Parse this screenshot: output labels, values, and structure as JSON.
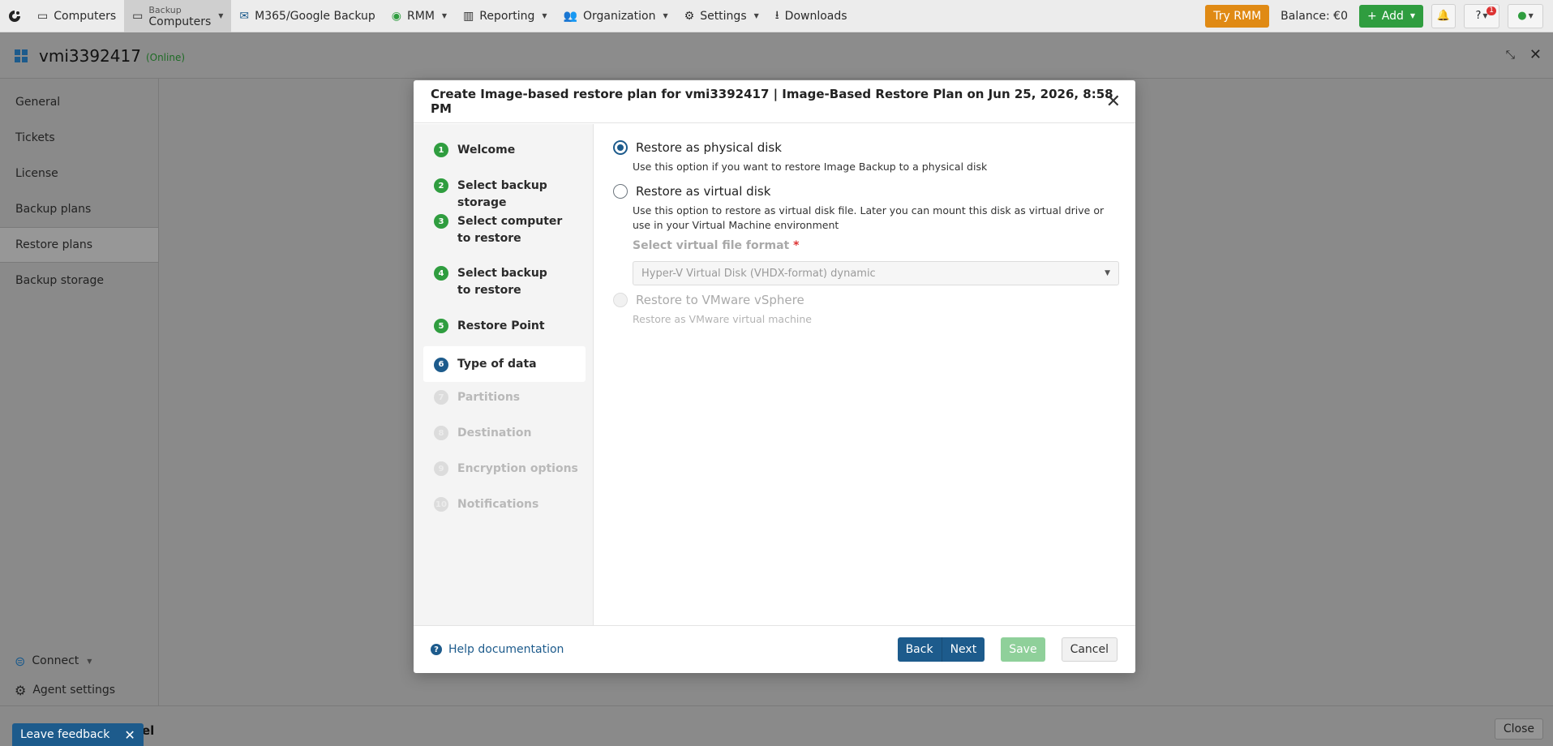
{
  "nav": {
    "items": [
      {
        "label": "Computers",
        "icon": "monitor-icon"
      },
      {
        "small": "Backup",
        "label": "Computers",
        "icon": "monitor-icon"
      },
      {
        "label": "M365/Google Backup",
        "icon": "mail-icon"
      },
      {
        "label": "RMM",
        "icon": "rmm-icon"
      },
      {
        "label": "Reporting",
        "icon": "chart-icon"
      },
      {
        "label": "Organization",
        "icon": "people-icon"
      },
      {
        "label": "Settings",
        "icon": "gear-icon"
      },
      {
        "label": "Downloads",
        "icon": "download-icon"
      }
    ],
    "try_rmm": "Try RMM",
    "balance": "Balance: €0",
    "add": "Add",
    "help_badge": "1"
  },
  "computer": {
    "name": "vmi3392417",
    "status": "(Online)"
  },
  "sidebar": {
    "items": [
      {
        "label": "General"
      },
      {
        "label": "Tickets"
      },
      {
        "label": "License"
      },
      {
        "label": "Backup plans"
      },
      {
        "label": "Restore plans"
      },
      {
        "label": "Backup storage"
      }
    ],
    "connect": "Connect",
    "agent_settings": "Agent settings"
  },
  "bottom": {
    "feedback": "Leave feedback",
    "partial": "el",
    "close": "Close"
  },
  "modal": {
    "title": "Create Image-based restore plan for vmi3392417 | Image-Based Restore Plan on Jun 25, 2026, 8:58 PM",
    "steps": [
      {
        "num": "1",
        "label": "Welcome"
      },
      {
        "num": "2",
        "label": "Select backup storage"
      },
      {
        "num": "3",
        "label": "Select computer to restore"
      },
      {
        "num": "4",
        "label": "Select backup to restore"
      },
      {
        "num": "5",
        "label": "Restore Point"
      },
      {
        "num": "6",
        "label": "Type of data"
      },
      {
        "num": "7",
        "label": "Partitions"
      },
      {
        "num": "8",
        "label": "Destination"
      },
      {
        "num": "9",
        "label": "Encryption options"
      },
      {
        "num": "10",
        "label": "Notifications"
      }
    ],
    "options": {
      "physical": {
        "label": "Restore as physical disk",
        "desc": "Use this option if you want to restore Image Backup to a physical disk",
        "selected": true
      },
      "virtual": {
        "label": "Restore as virtual disk",
        "desc": "Use this option to restore as virtual disk file. Later you can mount this disk as virtual drive or use in your Virtual Machine environment",
        "format_label": "Select virtual file format",
        "format_required": "*",
        "format_value": "Hyper-V Virtual Disk (VHDX-format) dynamic"
      },
      "vsphere": {
        "label": "Restore to VMware vSphere",
        "desc": "Restore as VMware virtual machine"
      }
    },
    "footer": {
      "help": "Help documentation",
      "back": "Back",
      "next": "Next",
      "save": "Save",
      "cancel": "Cancel"
    }
  }
}
